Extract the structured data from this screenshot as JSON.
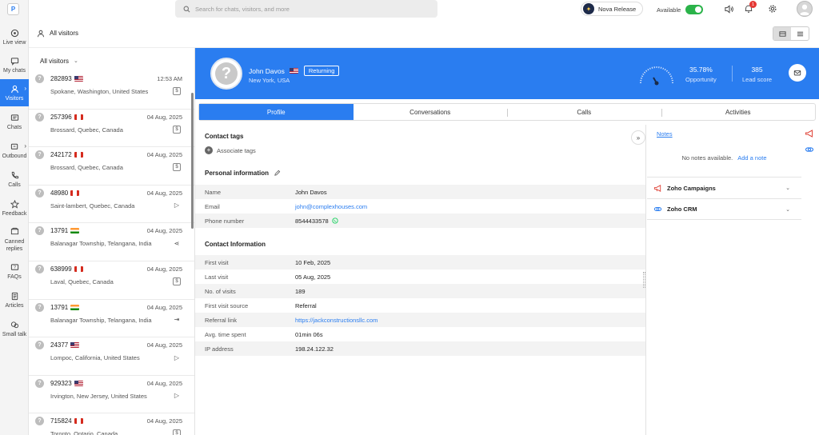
{
  "topbar": {
    "search_placeholder": "Search for chats, visitors, and more",
    "nova_label": "Nova Release",
    "available_label": "Available",
    "notification_count": "1"
  },
  "rail": {
    "logo": "P",
    "items": [
      {
        "label": "Live view",
        "icon": "live-view-icon"
      },
      {
        "label": "My chats",
        "icon": "chat-bubble-icon"
      },
      {
        "label": "Visitors",
        "icon": "person-icon"
      },
      {
        "label": "Chats",
        "icon": "chats-icon"
      },
      {
        "label": "Outbound",
        "icon": "outbound-icon"
      },
      {
        "label": "Calls",
        "icon": "phone-icon"
      },
      {
        "label": "Feedback",
        "icon": "star-icon"
      },
      {
        "label": "Canned replies",
        "icon": "canned-icon"
      },
      {
        "label": "FAQs",
        "icon": "faq-icon"
      },
      {
        "label": "Articles",
        "icon": "article-icon"
      },
      {
        "label": "Small talk",
        "icon": "small-talk-icon"
      }
    ]
  },
  "subhead": {
    "title": "All visitors"
  },
  "list": {
    "filter_label": "All visitors",
    "rows": [
      {
        "id": "282893",
        "flag": "us",
        "time": "12:53 AM",
        "location": "Spokane, Washington, United States",
        "source": "$"
      },
      {
        "id": "257396",
        "flag": "ca",
        "time": "04 Aug, 2025",
        "location": "Brossard, Quebec, Canada",
        "source": "$"
      },
      {
        "id": "242172",
        "flag": "ca",
        "time": "04 Aug, 2025",
        "location": "Brossard, Quebec, Canada",
        "source": "$"
      },
      {
        "id": "48980",
        "flag": "ca",
        "time": "04 Aug, 2025",
        "location": "Saint-lambert, Quebec, Canada",
        "source": "▷"
      },
      {
        "id": "13791",
        "flag": "in",
        "time": "04 Aug, 2025",
        "location": "Balanagar Township, Telangana, India",
        "source": "⋖"
      },
      {
        "id": "638999",
        "flag": "ca",
        "time": "04 Aug, 2025",
        "location": "Laval, Quebec, Canada",
        "source": "$"
      },
      {
        "id": "13791",
        "flag": "in",
        "time": "04 Aug, 2025",
        "location": "Balanagar Township, Telangana, India",
        "source": "⇥"
      },
      {
        "id": "24377",
        "flag": "us",
        "time": "04 Aug, 2025",
        "location": "Lompoc, California, United States",
        "source": "▷"
      },
      {
        "id": "929323",
        "flag": "us",
        "time": "04 Aug, 2025",
        "location": "Irvington, New Jersey, United States",
        "source": "▷"
      },
      {
        "id": "715824",
        "flag": "ca",
        "time": "04 Aug, 2025",
        "location": "Toronto, Ontario, Canada",
        "source": "$"
      }
    ]
  },
  "visitor": {
    "name": "John Davos",
    "status": "Returning",
    "city": "New York, USA",
    "opportunity_value": "35.78%",
    "opportunity_label": "Opportunity",
    "lead_value": "385",
    "lead_label": "Lead score",
    "gauge_fraction": 0.36
  },
  "tabs": [
    "Profile",
    "Conversations",
    "Calls",
    "Activities"
  ],
  "profile": {
    "contact_tags_title": "Contact tags",
    "associate_label": "Associate tags",
    "personal_title": "Personal information",
    "personal": [
      {
        "k": "Name",
        "v": "John Davos"
      },
      {
        "k": "Email",
        "v": "john@complexhouses.com"
      },
      {
        "k": "Phone number",
        "v": "8544433578"
      }
    ],
    "contact_title": "Contact Information",
    "contact": [
      {
        "k": "First visit",
        "v": "10 Feb, 2025"
      },
      {
        "k": "Last visit",
        "v": "05 Aug, 2025"
      },
      {
        "k": "No. of visits",
        "v": "189"
      },
      {
        "k": "First visit source",
        "v": "Referral"
      },
      {
        "k": "Referral link",
        "v": "https://jackconstructionsllc.com"
      },
      {
        "k": "Avg. time spent",
        "v": "01min 06s"
      },
      {
        "k": "IP address",
        "v": "198.24.122.32"
      }
    ]
  },
  "right": {
    "notes_tab": "Notes",
    "notes_empty": "No notes available.",
    "add_note": "Add a note",
    "integrations": [
      "Zoho Campaigns",
      "Zoho CRM"
    ]
  },
  "colors": {
    "accent": "#2a7df0",
    "available": "#2bb34a"
  }
}
